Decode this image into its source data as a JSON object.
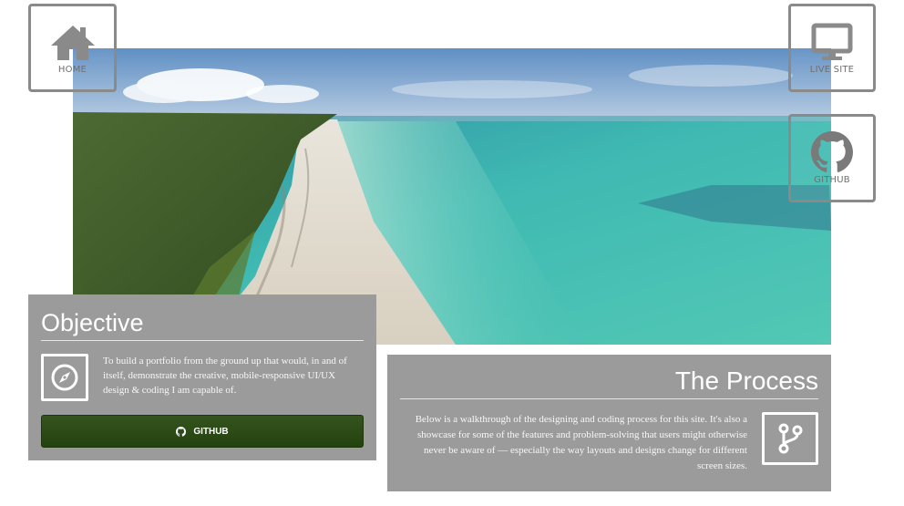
{
  "nav": {
    "home": {
      "label": "HOME",
      "icon": "home-icon"
    },
    "live_site": {
      "label": "LIVE SITE",
      "icon": "monitor-icon"
    },
    "github": {
      "label": "GITHUB",
      "icon": "github-icon"
    }
  },
  "objective": {
    "title": "Objective",
    "icon": "compass-icon",
    "text": "To build a portfolio from the ground up that would, in and of itself, demonstrate the creative, mobile-responsive UI/UX design & coding I am capable of.",
    "button_label": "GITHUB",
    "button_icon": "github-icon"
  },
  "process": {
    "title": "The Process",
    "icon": "git-branch-icon",
    "text": "Below is a walkthrough of the designing and coding process for this site. It's also a showcase for some of the features and problem-solving that users might otherwise never be aware of — especially the way layouts and designs change for different screen sizes."
  },
  "colors": {
    "card_background": "#9b9b9b",
    "button_green": "#2c4a16",
    "nav_border": "#8a8a8a"
  }
}
